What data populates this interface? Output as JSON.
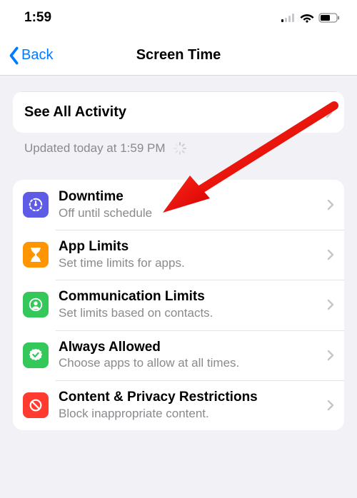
{
  "status": {
    "time": "1:59"
  },
  "nav": {
    "back": "Back",
    "title": "Screen Time"
  },
  "activity": {
    "see_all": "See All Activity",
    "updated": "Updated today at 1:59 PM"
  },
  "rows": {
    "downtime": {
      "title": "Downtime",
      "sub": "Off until schedule"
    },
    "applimits": {
      "title": "App Limits",
      "sub": "Set time limits for apps."
    },
    "commlimits": {
      "title": "Communication Limits",
      "sub": "Set limits based on contacts."
    },
    "always": {
      "title": "Always Allowed",
      "sub": "Choose apps to allow at all times."
    },
    "content": {
      "title": "Content & Privacy Restrictions",
      "sub": "Block inappropriate content."
    }
  },
  "colors": {
    "accent": "#007aff",
    "purple": "#5e5ce6",
    "orange": "#ff9500",
    "green": "#34c759",
    "red": "#ff3b30"
  }
}
